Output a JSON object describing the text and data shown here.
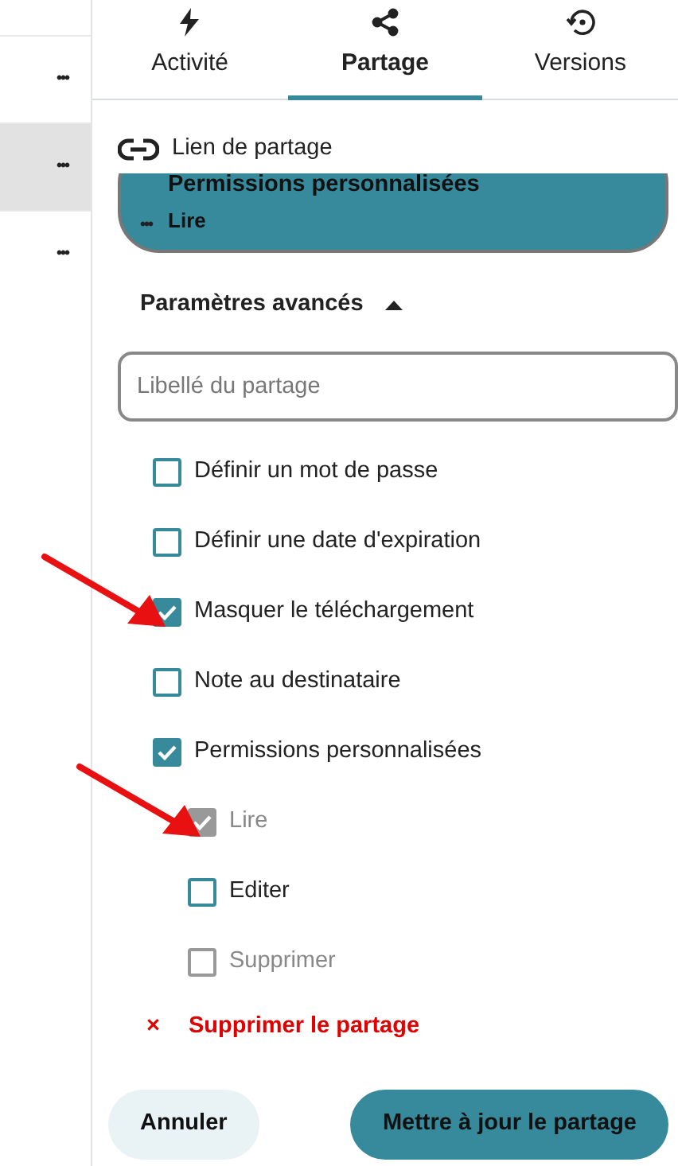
{
  "file_rows": [
    {
      "selected": false,
      "menu": "•••"
    },
    {
      "selected": true,
      "menu": "•••"
    },
    {
      "selected": false,
      "menu": "•••"
    }
  ],
  "tabs": [
    {
      "label": "Activité",
      "selected": false
    },
    {
      "label": "Partage",
      "selected": true
    },
    {
      "label": "Versions",
      "selected": false
    }
  ],
  "share_link": {
    "heading": "Lien de partage",
    "menu": "•••",
    "title": "Permissions personnalisées",
    "subtitle": "Lire"
  },
  "advanced": {
    "label": "Paramètres avancés",
    "expanded": true
  },
  "label_field": {
    "placeholder": "Libellé du partage"
  },
  "options": [
    {
      "label": "Définir un mot de passe",
      "checked": false,
      "disabled": false,
      "arrow": false
    },
    {
      "label": "Définir une date d'expiration",
      "checked": false,
      "disabled": false,
      "arrow": false
    },
    {
      "label": "Masquer le téléchargement",
      "checked": true,
      "disabled": false,
      "arrow": true
    },
    {
      "label": "Note au destinataire",
      "checked": false,
      "disabled": false,
      "arrow": false
    },
    {
      "label": "Permissions personnalisées",
      "checked": true,
      "disabled": false,
      "arrow": false,
      "children": [
        {
          "label": "Lire",
          "checked": true,
          "disabled": true,
          "arrow": true
        },
        {
          "label": "Editer",
          "checked": false,
          "disabled": false,
          "arrow": false
        },
        {
          "label": "Supprimer",
          "checked": false,
          "disabled": true,
          "arrow": false
        }
      ]
    }
  ],
  "delete": {
    "icon": "×",
    "label": "Supprimer le partage"
  },
  "buttons": [
    {
      "label": "Annuler",
      "kind": "secondary"
    },
    {
      "label": "Mettre à jour le partage",
      "kind": "primary"
    }
  ]
}
